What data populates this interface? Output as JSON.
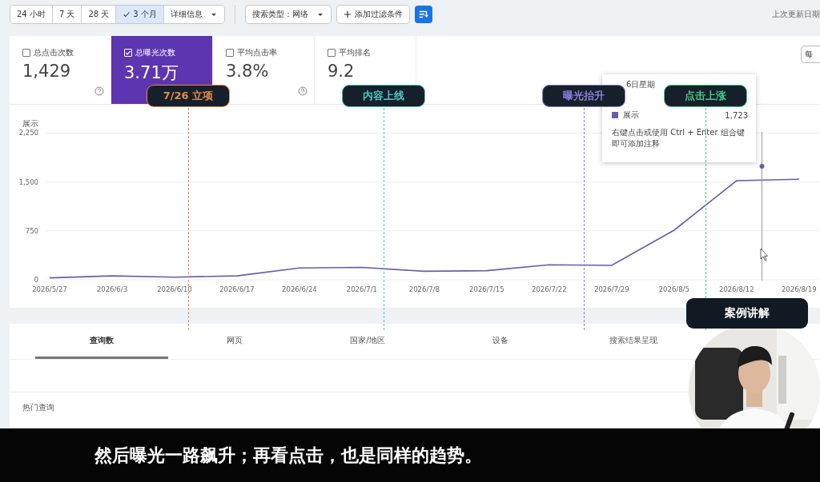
{
  "toolbar": {
    "ranges": [
      {
        "label": "24 小时",
        "selected": false
      },
      {
        "label": "7 天",
        "selected": false
      },
      {
        "label": "28 天",
        "selected": false
      },
      {
        "label": "3 个月",
        "selected": true
      }
    ],
    "details": "详细信息",
    "search_type": "搜索类型：网络",
    "add_filter": "添加过滤条件",
    "last_updated": "上次更新日期"
  },
  "metrics": [
    {
      "label": "总点击次数",
      "value": "1,429",
      "checked": false,
      "help": true
    },
    {
      "label": "总曝光次数",
      "value": "3.71万",
      "checked": true,
      "help": false
    },
    {
      "label": "平均点击率",
      "value": "3.8%",
      "checked": false,
      "help": true
    },
    {
      "label": "平均排名",
      "value": "9.2",
      "checked": false
    }
  ],
  "right_button": "每",
  "chart_data": {
    "type": "line",
    "ylabel": "展示",
    "ylim": [
      0,
      2250
    ],
    "yticks": [
      0,
      {
        "value": 750,
        "label": "750"
      },
      {
        "value": 1500,
        "label": "1,500"
      },
      {
        "value": 2250,
        "label": "2,250"
      }
    ],
    "categories": [
      "2026/5/27",
      "2026/6/3",
      "2026/6/10",
      "2026/6/17",
      "2026/6/24",
      "2026/7/1",
      "2026/7/8",
      "2026/7/15",
      "2026/7/22",
      "2026/7/29",
      "2026/8/5",
      "2026/8/12",
      "2026/8/19"
    ],
    "series": [
      {
        "name": "展示",
        "color": "#6a5bb0",
        "values": [
          30,
          60,
          40,
          60,
          180,
          190,
          130,
          140,
          230,
          220,
          760,
          1520,
          1540
        ]
      }
    ]
  },
  "markers": [
    {
      "label": "7/26 立项",
      "color": "#e8894a"
    },
    {
      "label": "内容上线",
      "color": "#4ec6c6"
    },
    {
      "label": "曝光抬升",
      "color": "#8a7ee0"
    },
    {
      "label": "点击上涨",
      "color": "#45c98a"
    }
  ],
  "tooltip": {
    "date": "6日星期",
    "value": "1,723",
    "hint": "右键点击或使用 Ctrl + Enter 组合键即可添加注释"
  },
  "tabs": [
    {
      "label": "查询数",
      "selected": true
    },
    {
      "label": "网页",
      "selected": false
    },
    {
      "label": "国家/地区",
      "selected": false
    },
    {
      "label": "设备",
      "selected": false
    },
    {
      "label": "搜索结果呈现",
      "selected": false
    }
  ],
  "table_heading": "热门查询",
  "presenter": {
    "badge": "案例讲解",
    "kind": "picture"
  },
  "subtitle": "然后曝光一路飙升；再看点击，也是同样的趋势。"
}
